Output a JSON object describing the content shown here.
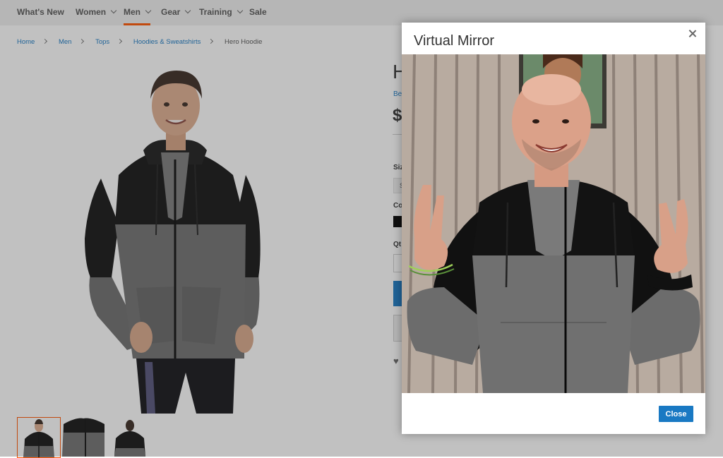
{
  "nav": {
    "items": [
      {
        "label": "What's New"
      },
      {
        "label": "Women"
      },
      {
        "label": "Men"
      },
      {
        "label": "Gear"
      },
      {
        "label": "Training"
      },
      {
        "label": "Sale"
      }
    ],
    "active": "Men"
  },
  "breadcrumb": [
    "Home",
    "Men",
    "Tops",
    "Hoodies & Sweatshirts",
    "Hero Hoodie"
  ],
  "product": {
    "title_partial": "H",
    "reviews_partial": "Be",
    "price_partial": "$",
    "size_label_partial": "Siz",
    "size_option_partial": "S",
    "color_label_partial": "Co",
    "qty_label_partial": "Qt"
  },
  "modal": {
    "title": "Virtual Mirror",
    "close_button": "Close"
  },
  "colors": {
    "accent": "#ff5501",
    "primary_button": "#1979c3",
    "hoodie_black": "#141414",
    "hoodie_gray": "#6f6f6f"
  }
}
